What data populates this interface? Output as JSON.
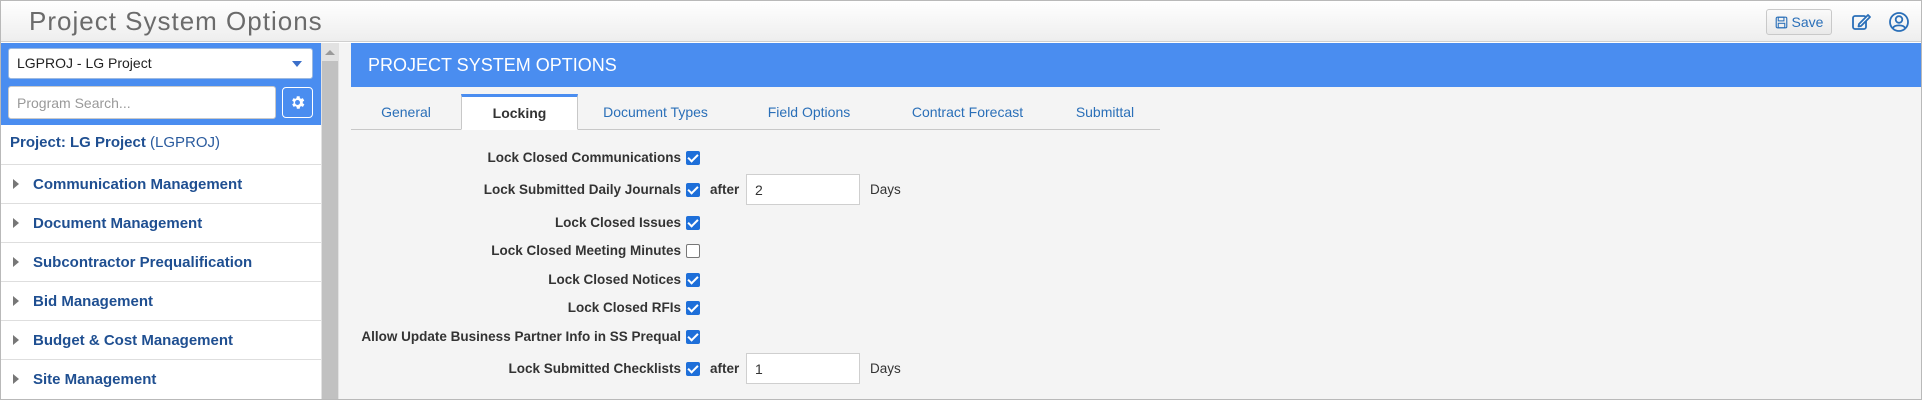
{
  "app": {
    "title": "Project System Options",
    "save_label": "Save"
  },
  "sidebar": {
    "project_select": "LGPROJ - LG Project",
    "search_placeholder": "Program Search...",
    "project_label_prefix": "Project: LG Project",
    "project_label_code": "(LGPROJ)",
    "items": [
      {
        "label": "Communication Management"
      },
      {
        "label": "Document Management"
      },
      {
        "label": "Subcontractor Prequalification"
      },
      {
        "label": "Bid Management"
      },
      {
        "label": "Budget & Cost Management"
      },
      {
        "label": "Site Management"
      }
    ]
  },
  "main": {
    "header": "PROJECT SYSTEM OPTIONS",
    "tabs": [
      {
        "label": "General",
        "active": false
      },
      {
        "label": "Locking",
        "active": true
      },
      {
        "label": "Document Types",
        "active": false
      },
      {
        "label": "Field Options",
        "active": false
      },
      {
        "label": "Contract Forecast",
        "active": false
      },
      {
        "label": "Submittal",
        "active": false
      }
    ],
    "options": [
      {
        "label": "Lock Closed Communications",
        "checked": true
      },
      {
        "label": "Lock Submitted Daily Journals",
        "checked": true,
        "after_label": "after",
        "after_value": "2",
        "unit": "Days"
      },
      {
        "label": "Lock Closed Issues",
        "checked": true
      },
      {
        "label": "Lock Closed Meeting Minutes",
        "checked": false
      },
      {
        "label": "Lock Closed Notices",
        "checked": true
      },
      {
        "label": "Lock Closed RFIs",
        "checked": true
      },
      {
        "label": "Allow Update Business Partner Info in SS Prequal",
        "checked": true
      },
      {
        "label": "Lock Submitted Checklists",
        "checked": true,
        "after_label": "after",
        "after_value": "1",
        "unit": "Days"
      }
    ]
  },
  "colors": {
    "accent": "#4a8df0",
    "link": "#1f4f91",
    "checkbox": "#1e6fd9"
  }
}
